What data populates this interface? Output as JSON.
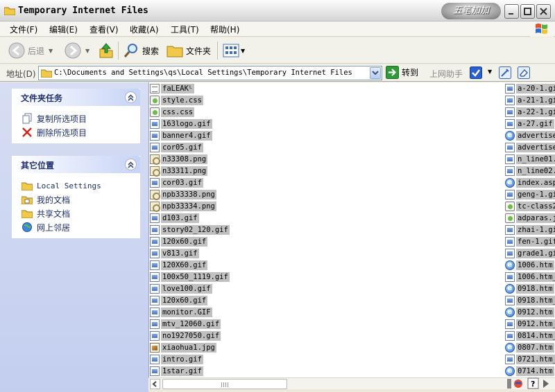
{
  "window": {
    "title": "Temporary Internet Files",
    "brand": "五笔加加"
  },
  "menu": [
    "文件(F)",
    "编辑(E)",
    "查看(V)",
    "收藏(A)",
    "工具(T)",
    "帮助(H)"
  ],
  "toolbar": {
    "back": "后退",
    "search": "搜索",
    "folders": "文件夹"
  },
  "address": {
    "label": "地址(D)",
    "path": "C:\\Documents and Settings\\qs\\Local Settings\\Temporary Internet Files",
    "go": "转到",
    "helper": "上网助手"
  },
  "tasks": {
    "title": "文件夹任务",
    "items": [
      "复制所选项目",
      "删除所选项目"
    ]
  },
  "places": {
    "title": "其它位置",
    "items": [
      "Local Settings",
      "我的文档",
      "共享文档",
      "网上邻居"
    ]
  },
  "files_col1": [
    {
      "name": "faLEAKᴸ",
      "type": "txt"
    },
    {
      "name": "style.css",
      "type": "css"
    },
    {
      "name": "css.css",
      "type": "css"
    },
    {
      "name": "163logo.gif",
      "type": "img"
    },
    {
      "name": "banner4.gif",
      "type": "img"
    },
    {
      "name": "cor05.gif",
      "type": "img"
    },
    {
      "name": "n33308.png",
      "type": "png"
    },
    {
      "name": "n33311.png",
      "type": "png"
    },
    {
      "name": "cor03.gif",
      "type": "img"
    },
    {
      "name": "npb33338.png",
      "type": "png"
    },
    {
      "name": "npb33334.png",
      "type": "png"
    },
    {
      "name": "d103.gif",
      "type": "img"
    },
    {
      "name": "story02_120.gif",
      "type": "img"
    },
    {
      "name": "120x60.gif",
      "type": "img"
    },
    {
      "name": "v813.gif",
      "type": "img"
    },
    {
      "name": "120X60.gif",
      "type": "img"
    },
    {
      "name": "100x50_1119.gif",
      "type": "img"
    },
    {
      "name": "love100.gif",
      "type": "img"
    },
    {
      "name": "120x60.gif",
      "type": "img"
    },
    {
      "name": "monitor.GIF",
      "type": "img"
    },
    {
      "name": "mtv_12060.gif",
      "type": "img"
    },
    {
      "name": "no1927050.gif",
      "type": "img"
    },
    {
      "name": "xiaohua1.jpg",
      "type": "jpg"
    },
    {
      "name": "intro.gif",
      "type": "img"
    },
    {
      "name": "1star.gif",
      "type": "img"
    }
  ],
  "files_col2": [
    {
      "name": "a-20-1.gi",
      "type": "img"
    },
    {
      "name": "a-21-1.gi",
      "type": "img"
    },
    {
      "name": "a-22-1.gi",
      "type": "img"
    },
    {
      "name": "a-27.gif",
      "type": "img"
    },
    {
      "name": "advertise",
      "type": "ie"
    },
    {
      "name": "advertise",
      "type": "img"
    },
    {
      "name": "n_line01.",
      "type": "img"
    },
    {
      "name": "n_line02.",
      "type": "img"
    },
    {
      "name": "index.asp",
      "type": "ie"
    },
    {
      "name": "geng-1.gi",
      "type": "img"
    },
    {
      "name": "tc-class2",
      "type": "css"
    },
    {
      "name": "adparas.j",
      "type": "css"
    },
    {
      "name": "zhai-1.gi",
      "type": "img"
    },
    {
      "name": "fen-1.gif",
      "type": "img"
    },
    {
      "name": "grade1.gi",
      "type": "img"
    },
    {
      "name": "1006.htm",
      "type": "ie"
    },
    {
      "name": "1006.htm_",
      "type": "img"
    },
    {
      "name": "0918.htm",
      "type": "ie"
    },
    {
      "name": "0918.htm_",
      "type": "img"
    },
    {
      "name": "0912.htm",
      "type": "ie"
    },
    {
      "name": "0912.htm_",
      "type": "img"
    },
    {
      "name": "0814.htm_",
      "type": "img"
    },
    {
      "name": "0807.htm",
      "type": "ie"
    },
    {
      "name": "0721.htm_",
      "type": "img"
    },
    {
      "name": "0714.htm",
      "type": "ie"
    }
  ],
  "icons": {
    "folder": "folder-icon",
    "back": "back-arrow-icon",
    "forward": "forward-arrow-icon",
    "up": "up-folder-icon",
    "search": "magnifier-icon",
    "views": "views-icon"
  },
  "colors": {
    "taskpane": "#c6d3f7",
    "selection": "#c0c0c0",
    "go": "#2f9a3a"
  }
}
